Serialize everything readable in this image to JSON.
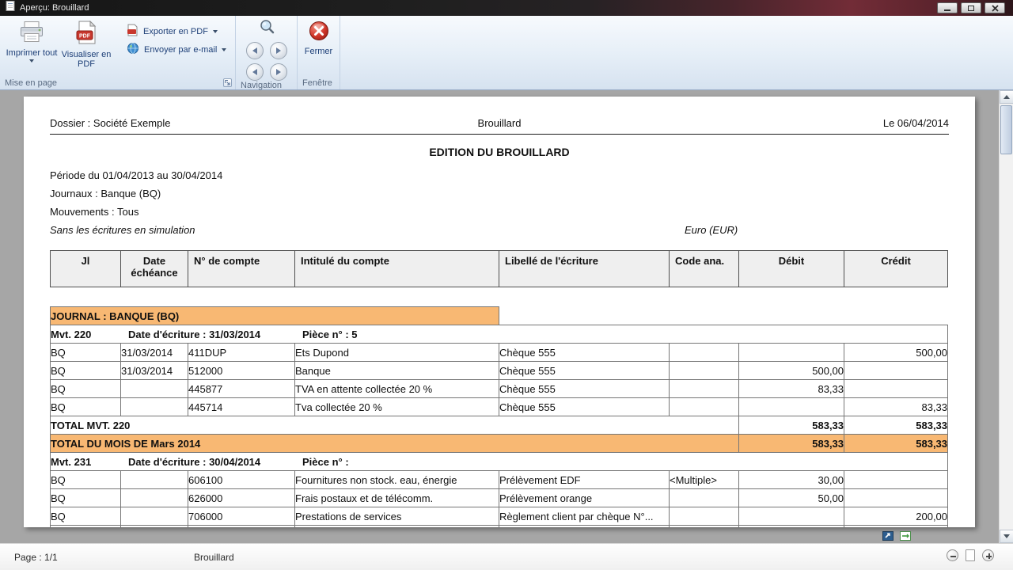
{
  "window": {
    "title": "Aperçu: Brouillard"
  },
  "ribbon": {
    "print_all": "Imprimer tout",
    "view_pdf": "Visualiser en PDF",
    "export_pdf": "Exporter en PDF",
    "send_email": "Envoyer par e-mail",
    "close": "Fermer",
    "groups": {
      "page_setup": "Mise en page",
      "navigation": "Navigation",
      "window": "Fenêtre"
    }
  },
  "icons": {
    "pdf_label": "PDF"
  },
  "doc": {
    "header_left": "Dossier : Société Exemple",
    "header_center": "Brouillard",
    "header_right": "Le 06/04/2014",
    "title": "EDITION DU BROUILLARD",
    "period": "Période du 01/04/2013 au 30/04/2014",
    "journals": "Journaux : Banque (BQ)",
    "movements": "Mouvements : Tous",
    "simulation_note": "Sans les écritures en simulation",
    "currency": "Euro (EUR)",
    "columns": [
      "Jl",
      "Date\néchéance",
      "N° de compte",
      "Intitulé du compte",
      "Libellé de l'écriture",
      "Code ana.",
      "Débit",
      "Crédit"
    ],
    "journal_band": "JOURNAL : BANQUE (BQ)",
    "mvt1": {
      "label": "Mvt. 220",
      "date": "Date d'écriture : 31/03/2014",
      "piece": "Pièce n° : 5"
    },
    "mvt2": {
      "label": "Mvt. 231",
      "date": "Date d'écriture : 30/04/2014",
      "piece": "Pièce n° :"
    },
    "rows": [
      {
        "jl": "BQ",
        "date": "31/03/2014",
        "compte": "411DUP",
        "intitule": "Ets Dupond",
        "libelle": "Chèque 555",
        "code": "",
        "debit": "",
        "credit": "500,00"
      },
      {
        "jl": "BQ",
        "date": "31/03/2014",
        "compte": "512000",
        "intitule": "Banque",
        "libelle": "Chèque 555",
        "code": "",
        "debit": "500,00",
        "credit": ""
      },
      {
        "jl": "BQ",
        "date": "",
        "compte": "445877",
        "intitule": "TVA en attente collectée 20 %",
        "libelle": "Chèque 555",
        "code": "",
        "debit": "83,33",
        "credit": ""
      },
      {
        "jl": "BQ",
        "date": "",
        "compte": "445714",
        "intitule": "Tva collectée 20 %",
        "libelle": "Chèque 555",
        "code": "",
        "debit": "",
        "credit": "83,33"
      },
      {
        "jl": "BQ",
        "date": "",
        "compte": "606100",
        "intitule": "Fournitures non stock. eau, énergie",
        "libelle": "Prélèvement EDF",
        "code": "<Multiple>",
        "debit": "30,00",
        "credit": ""
      },
      {
        "jl": "BQ",
        "date": "",
        "compte": "626000",
        "intitule": "Frais postaux et de télécomm.",
        "libelle": "Prélèvement orange",
        "code": "",
        "debit": "50,00",
        "credit": ""
      },
      {
        "jl": "BQ",
        "date": "",
        "compte": "706000",
        "intitule": "Prestations de services",
        "libelle": "Règlement client par chèque N°...",
        "code": "",
        "debit": "",
        "credit": "200,00"
      }
    ],
    "total_mvt": {
      "label": "TOTAL MVT. 220",
      "debit": "583,33",
      "credit": "583,33"
    },
    "total_month": {
      "label": "TOTAL DU MOIS DE Mars 2014",
      "debit": "583,33",
      "credit": "583,33"
    }
  },
  "statusbar": {
    "page": "Page : 1/1",
    "doc_name": "Brouillard"
  },
  "colors": {
    "accent_orange": "#F8B873",
    "header_gray": "#EFEFEF"
  }
}
